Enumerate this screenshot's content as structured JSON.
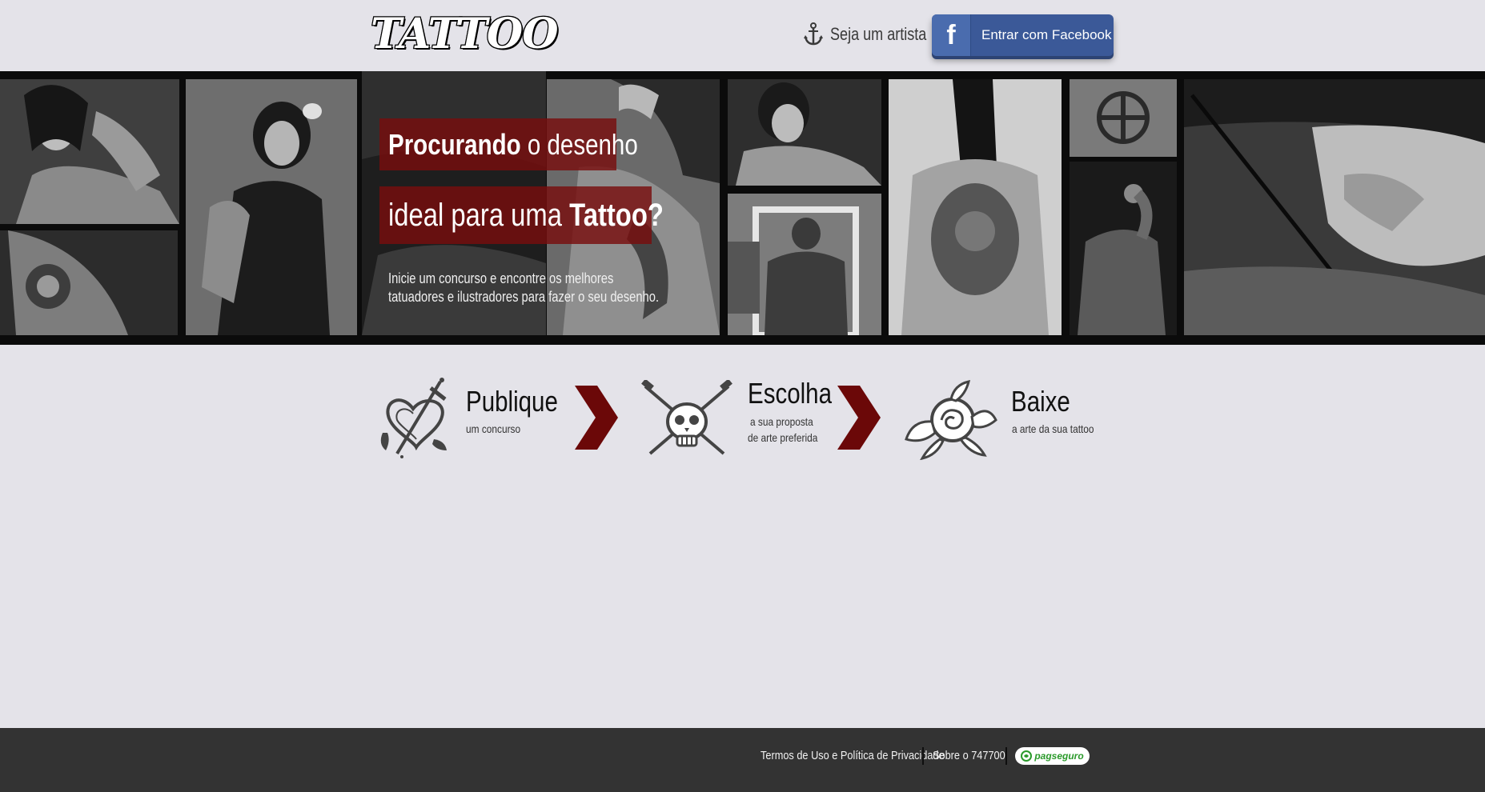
{
  "header": {
    "logo_text": "TATTOO",
    "artist_link": "Seja um artista",
    "facebook_button": "Entrar com Facebook",
    "facebook_icon": "f"
  },
  "hero": {
    "headline1_strong": "Procurando",
    "headline1_rest": " o desenho",
    "headline2_rest": "ideal para uma ",
    "headline2_strong": "Tattoo?",
    "subtitle_line1": "Inicie um concurso e encontre os melhores",
    "subtitle_line2": "tatuadores e ilustradores para fazer o seu desenho."
  },
  "steps": [
    {
      "title": "Publique",
      "subtitle_line1": "um concurso",
      "subtitle_line2": "",
      "icon": "heart-dagger-icon"
    },
    {
      "title": "Escolha",
      "subtitle_line1": "a sua proposta",
      "subtitle_line2": "de arte preferida",
      "icon": "skull-daggers-icon"
    },
    {
      "title": "Baixe",
      "subtitle_line1": "a arte da sua tattoo",
      "subtitle_line2": "",
      "icon": "rose-icon"
    }
  ],
  "footer": {
    "terms_link": "Termos de Uso e Política de Privacidade",
    "about_link": "Sobre o 747700",
    "payment_badge": "pagseguro"
  },
  "colors": {
    "page_bg": "#e4e3e9",
    "hero_bg": "#0b0b0b",
    "headline_box": "#780e0e",
    "chevron": "#6b0808",
    "facebook": "#3b5998",
    "footer_bg": "#333333",
    "pagseguro_green": "#2b9a2b"
  }
}
